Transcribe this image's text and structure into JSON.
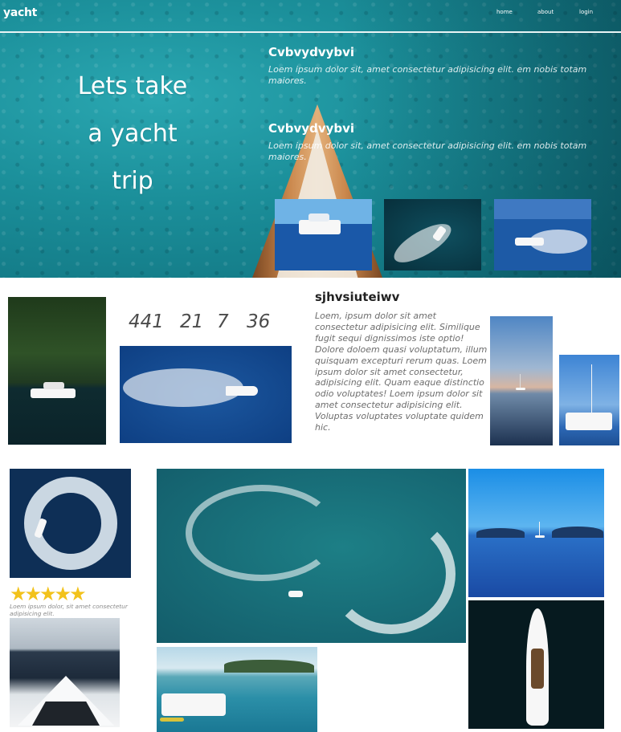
{
  "header": {
    "brand": "yacht",
    "nav": [
      "home",
      "about",
      "login"
    ]
  },
  "hero": {
    "title_lines": [
      "Lets take",
      "a yacht",
      "trip"
    ],
    "blocks": [
      {
        "heading": "Cvbvydvybvi",
        "text": "Loem ipsum dolor sit, amet consectetur adipisicing elit. em nobis totam maiores."
      },
      {
        "heading": "Cvbvydvybvi",
        "text": "Loem ipsum dolor sit, amet consectetur adipisicing elit. em nobis totam maiores."
      }
    ]
  },
  "stats": [
    "441",
    "21",
    "7",
    "36"
  ],
  "feature": {
    "title": "sjhvsiuteiwv",
    "text": "Loem, ipsum dolor sit amet consectetur adipisicing elit. Similique fugit sequi dignissimos iste optio! Dolore doloem quasi voluptatum, illum quisquam excepturi rerum quas. Loem ipsum dolor sit amet consectetur, adipisicing elit. Quam eaque distinctio odio voluptates! Loem ipsum dolor sit amet consectetur adipisicing elit. Voluptas voluptates voluptate quidem hic."
  },
  "review": {
    "stars": "★★★★★",
    "rating": 5,
    "text": "Loem ipsum dolor, sit amet consectetur adipisicing elit."
  },
  "colors": {
    "sea": "#1b8f9a",
    "star": "#f2c21b",
    "text_dark": "#222222",
    "text_muted": "#6d6d6d"
  }
}
